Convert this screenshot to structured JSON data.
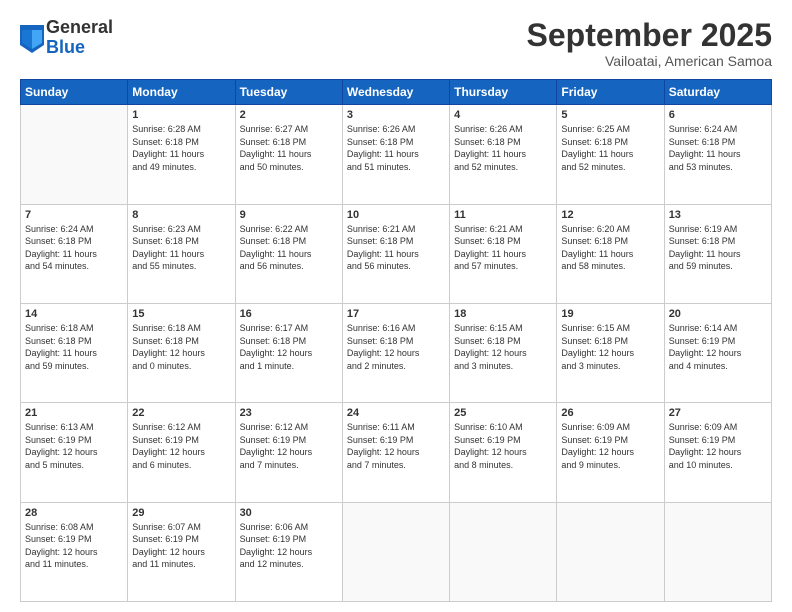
{
  "logo": {
    "general": "General",
    "blue": "Blue"
  },
  "title": "September 2025",
  "subtitle": "Vailoatai, American Samoa",
  "days_header": [
    "Sunday",
    "Monday",
    "Tuesday",
    "Wednesday",
    "Thursday",
    "Friday",
    "Saturday"
  ],
  "weeks": [
    [
      {
        "day": "",
        "info": ""
      },
      {
        "day": "1",
        "info": "Sunrise: 6:28 AM\nSunset: 6:18 PM\nDaylight: 11 hours\nand 49 minutes."
      },
      {
        "day": "2",
        "info": "Sunrise: 6:27 AM\nSunset: 6:18 PM\nDaylight: 11 hours\nand 50 minutes."
      },
      {
        "day": "3",
        "info": "Sunrise: 6:26 AM\nSunset: 6:18 PM\nDaylight: 11 hours\nand 51 minutes."
      },
      {
        "day": "4",
        "info": "Sunrise: 6:26 AM\nSunset: 6:18 PM\nDaylight: 11 hours\nand 52 minutes."
      },
      {
        "day": "5",
        "info": "Sunrise: 6:25 AM\nSunset: 6:18 PM\nDaylight: 11 hours\nand 52 minutes."
      },
      {
        "day": "6",
        "info": "Sunrise: 6:24 AM\nSunset: 6:18 PM\nDaylight: 11 hours\nand 53 minutes."
      }
    ],
    [
      {
        "day": "7",
        "info": "Sunrise: 6:24 AM\nSunset: 6:18 PM\nDaylight: 11 hours\nand 54 minutes."
      },
      {
        "day": "8",
        "info": "Sunrise: 6:23 AM\nSunset: 6:18 PM\nDaylight: 11 hours\nand 55 minutes."
      },
      {
        "day": "9",
        "info": "Sunrise: 6:22 AM\nSunset: 6:18 PM\nDaylight: 11 hours\nand 56 minutes."
      },
      {
        "day": "10",
        "info": "Sunrise: 6:21 AM\nSunset: 6:18 PM\nDaylight: 11 hours\nand 56 minutes."
      },
      {
        "day": "11",
        "info": "Sunrise: 6:21 AM\nSunset: 6:18 PM\nDaylight: 11 hours\nand 57 minutes."
      },
      {
        "day": "12",
        "info": "Sunrise: 6:20 AM\nSunset: 6:18 PM\nDaylight: 11 hours\nand 58 minutes."
      },
      {
        "day": "13",
        "info": "Sunrise: 6:19 AM\nSunset: 6:18 PM\nDaylight: 11 hours\nand 59 minutes."
      }
    ],
    [
      {
        "day": "14",
        "info": "Sunrise: 6:18 AM\nSunset: 6:18 PM\nDaylight: 11 hours\nand 59 minutes."
      },
      {
        "day": "15",
        "info": "Sunrise: 6:18 AM\nSunset: 6:18 PM\nDaylight: 12 hours\nand 0 minutes."
      },
      {
        "day": "16",
        "info": "Sunrise: 6:17 AM\nSunset: 6:18 PM\nDaylight: 12 hours\nand 1 minute."
      },
      {
        "day": "17",
        "info": "Sunrise: 6:16 AM\nSunset: 6:18 PM\nDaylight: 12 hours\nand 2 minutes."
      },
      {
        "day": "18",
        "info": "Sunrise: 6:15 AM\nSunset: 6:18 PM\nDaylight: 12 hours\nand 3 minutes."
      },
      {
        "day": "19",
        "info": "Sunrise: 6:15 AM\nSunset: 6:18 PM\nDaylight: 12 hours\nand 3 minutes."
      },
      {
        "day": "20",
        "info": "Sunrise: 6:14 AM\nSunset: 6:19 PM\nDaylight: 12 hours\nand 4 minutes."
      }
    ],
    [
      {
        "day": "21",
        "info": "Sunrise: 6:13 AM\nSunset: 6:19 PM\nDaylight: 12 hours\nand 5 minutes."
      },
      {
        "day": "22",
        "info": "Sunrise: 6:12 AM\nSunset: 6:19 PM\nDaylight: 12 hours\nand 6 minutes."
      },
      {
        "day": "23",
        "info": "Sunrise: 6:12 AM\nSunset: 6:19 PM\nDaylight: 12 hours\nand 7 minutes."
      },
      {
        "day": "24",
        "info": "Sunrise: 6:11 AM\nSunset: 6:19 PM\nDaylight: 12 hours\nand 7 minutes."
      },
      {
        "day": "25",
        "info": "Sunrise: 6:10 AM\nSunset: 6:19 PM\nDaylight: 12 hours\nand 8 minutes."
      },
      {
        "day": "26",
        "info": "Sunrise: 6:09 AM\nSunset: 6:19 PM\nDaylight: 12 hours\nand 9 minutes."
      },
      {
        "day": "27",
        "info": "Sunrise: 6:09 AM\nSunset: 6:19 PM\nDaylight: 12 hours\nand 10 minutes."
      }
    ],
    [
      {
        "day": "28",
        "info": "Sunrise: 6:08 AM\nSunset: 6:19 PM\nDaylight: 12 hours\nand 11 minutes."
      },
      {
        "day": "29",
        "info": "Sunrise: 6:07 AM\nSunset: 6:19 PM\nDaylight: 12 hours\nand 11 minutes."
      },
      {
        "day": "30",
        "info": "Sunrise: 6:06 AM\nSunset: 6:19 PM\nDaylight: 12 hours\nand 12 minutes."
      },
      {
        "day": "",
        "info": ""
      },
      {
        "day": "",
        "info": ""
      },
      {
        "day": "",
        "info": ""
      },
      {
        "day": "",
        "info": ""
      }
    ]
  ]
}
